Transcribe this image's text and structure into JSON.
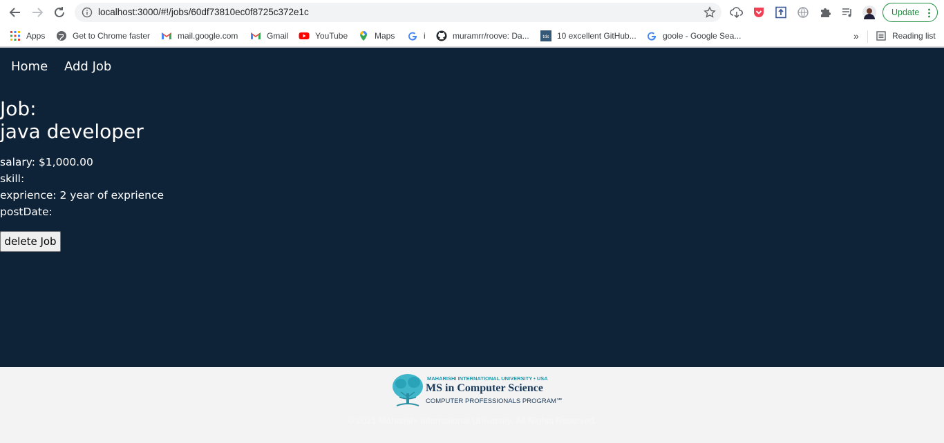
{
  "browser": {
    "url": "localhost:3000/#!/jobs/60df73810ec0f8725c372e1c",
    "update_label": "Update",
    "bookmarks": [
      {
        "label": "Apps",
        "icon": "apps-grid-icon"
      },
      {
        "label": "Get to Chrome faster",
        "icon": "chrome-globe-icon"
      },
      {
        "label": "mail.google.com",
        "icon": "gmail-icon"
      },
      {
        "label": "Gmail",
        "icon": "gmail-icon"
      },
      {
        "label": "YouTube",
        "icon": "youtube-icon"
      },
      {
        "label": "Maps",
        "icon": "maps-pin-icon"
      },
      {
        "label": "i",
        "icon": "google-g-icon"
      },
      {
        "label": "muramrr/roove: Da...",
        "icon": "github-icon"
      },
      {
        "label": "10 excellent GitHub...",
        "icon": "tds-icon"
      },
      {
        "label": "goole - Google Sea...",
        "icon": "google-g-icon"
      }
    ],
    "reading_list": "Reading list",
    "overflow": "»"
  },
  "nav": {
    "home": "Home",
    "add_job": "Add Job"
  },
  "job": {
    "heading": "Job:",
    "title": "java developer",
    "salary": "salary: $1,000.00",
    "skill": "skill:",
    "exprience": "exprience: 2 year of exprience",
    "post_date": "postDate:",
    "delete_label": "delete Job"
  },
  "footer": {
    "logo_top": "MAHARISHI INTERNATIONAL UNIVERSITY • USA",
    "logo_main": "MS in Computer Science",
    "logo_sub": "COMPUTER PROFESSIONALS PROGRAM℠",
    "copyright": "© 2021 Maharishi International University. All Rights Reserved."
  },
  "colors": {
    "app_background": "#0f2338",
    "footer_background": "#f3f3f3",
    "update_green": "#1e8e3e"
  }
}
